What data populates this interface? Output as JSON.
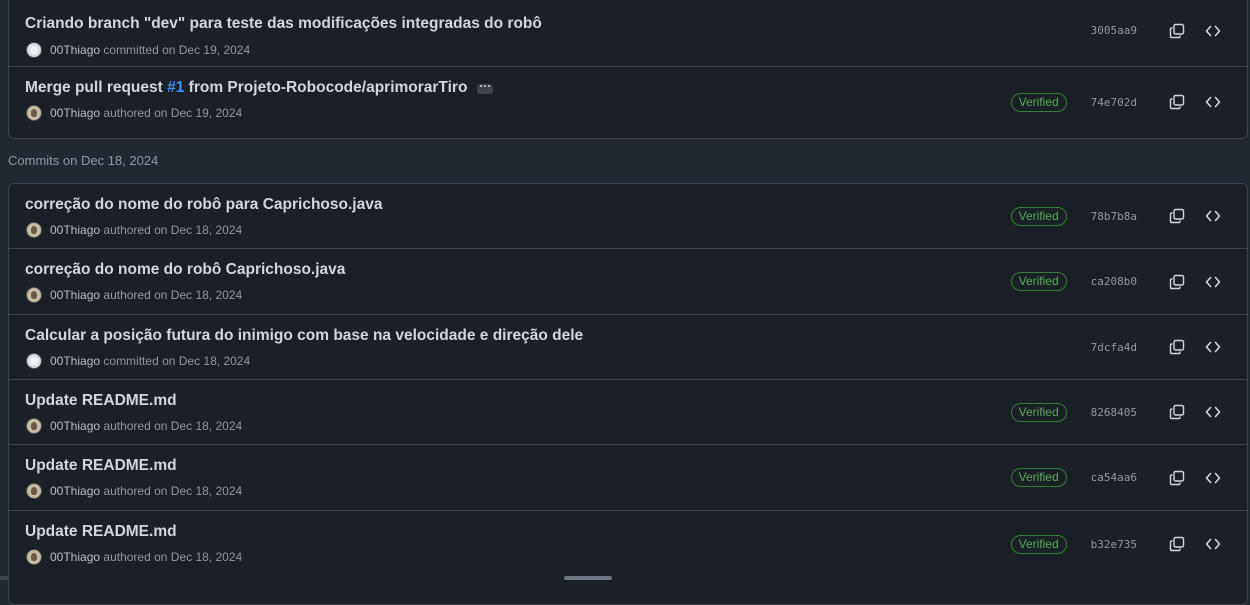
{
  "group1": {
    "commits": [
      {
        "title": "Criando branch \"dev\" para teste das modificações integradas do robô",
        "author": "00Thiago",
        "action": "committed on Dec 19, 2024",
        "sha": "3005aa9",
        "verified": ""
      },
      {
        "title_prefix": "Merge pull request ",
        "pr": "#1",
        "title_suffix": " from Projeto-Robocode/aprimorarTiro",
        "author": "00Thiago",
        "action": "authored on Dec 19, 2024",
        "sha": "74e702d",
        "verified": "Verified"
      }
    ]
  },
  "section_heading": "Commits on Dec 18, 2024",
  "group2": {
    "commits": [
      {
        "title": "correção do nome do robô para Caprichoso.java",
        "author": "00Thiago",
        "action": "authored on Dec 18, 2024",
        "sha": "78b7b8a",
        "verified": "Verified"
      },
      {
        "title": "correção do nome do robô Caprichoso.java",
        "author": "00Thiago",
        "action": "authored on Dec 18, 2024",
        "sha": "ca208b0",
        "verified": "Verified"
      },
      {
        "title": "Calcular a posição futura do inimigo com base na velocidade e direção dele",
        "author": "00Thiago",
        "action": "committed on Dec 18, 2024",
        "sha": "7dcfa4d",
        "verified": ""
      },
      {
        "title": "Update README.md",
        "author": "00Thiago",
        "action": "authored on Dec 18, 2024",
        "sha": "8268405",
        "verified": "Verified"
      },
      {
        "title": "Update README.md",
        "author": "00Thiago",
        "action": "authored on Dec 18, 2024",
        "sha": "ca54aa6",
        "verified": "Verified"
      },
      {
        "title": "Update README.md",
        "author": "00Thiago",
        "action": "authored on Dec 18, 2024",
        "sha": "b32e735",
        "verified": "Verified"
      }
    ]
  },
  "icons": {
    "copy": "copy-icon",
    "browse": "code-icon",
    "avatar": "avatar"
  }
}
